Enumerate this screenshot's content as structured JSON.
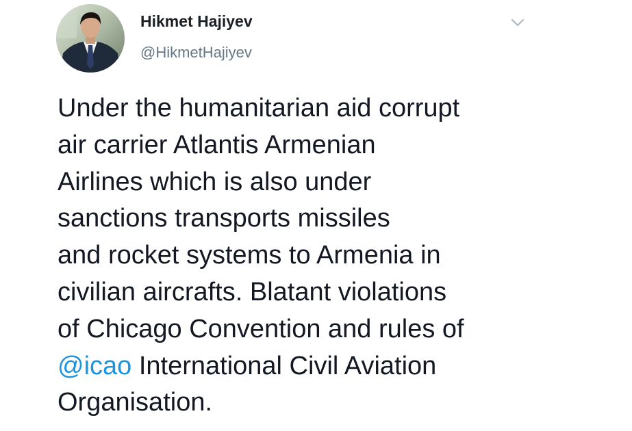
{
  "tweet": {
    "author": {
      "display_name": "Hikmet Hajiyev",
      "handle": "@HikmetHajiyev",
      "avatar_icon": "profile-photo"
    },
    "menu_icon": "chevron-down-icon",
    "text_lines": [
      {
        "text": "Under the humanitarian aid corrupt"
      },
      {
        "text": "air carrier Atlantis Armenian"
      },
      {
        "text": "Airlines which is also under"
      },
      {
        "text": "sanctions transports missiles"
      },
      {
        "text": "and rocket systems to Armenia in"
      },
      {
        "text": "civilian aircrafts. Blatant violations"
      },
      {
        "text": "of Chicago Convention and rules of"
      },
      {
        "mention": "@icao",
        "text": " International Civil Aviation"
      },
      {
        "text": "Organisation."
      }
    ],
    "colors": {
      "text": "#141823",
      "handle": "#657786",
      "mention": "#1b95e0",
      "caret": "#aab8c2"
    }
  }
}
